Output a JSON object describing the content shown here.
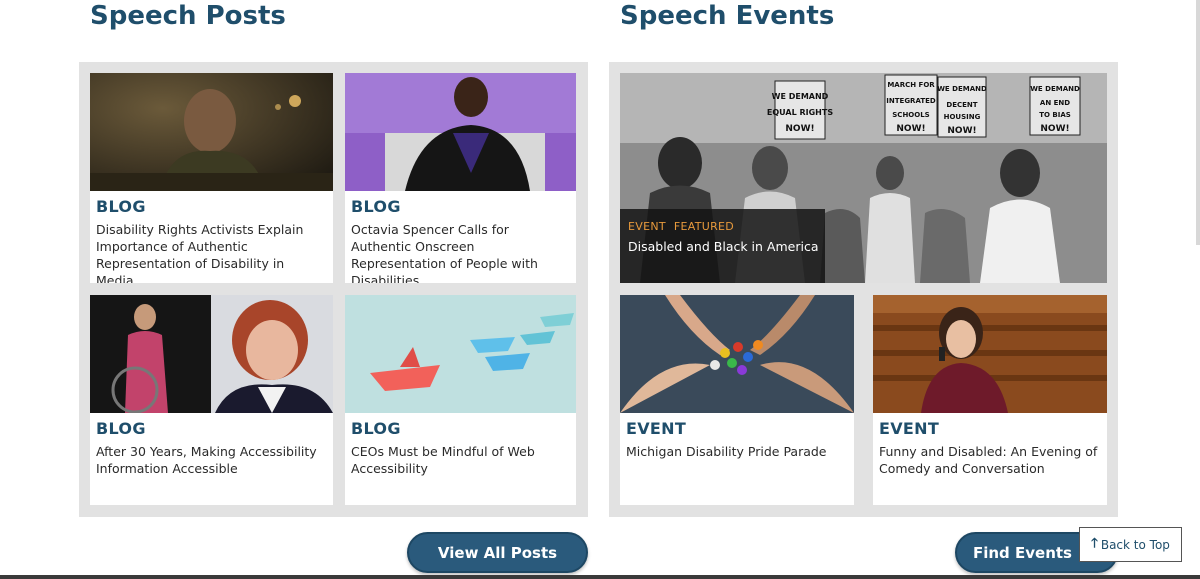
{
  "posts": {
    "title": "Speech Posts",
    "cards": [
      {
        "tag": "BLOG",
        "title": "Disability Rights Activists Explain Importance of Authentic Representation of Disability in Media",
        "image": "man-seated-at-table-photo"
      },
      {
        "tag": "BLOG",
        "title": "Octavia Spencer Calls for Authentic Onscreen Representation of People with Disabilities",
        "image": "woman-on-talk-show-photo"
      },
      {
        "tag": "BLOG",
        "title": "After 30 Years, Making Accessibility Information Accessible",
        "image": "two-women-portrait-photo"
      },
      {
        "tag": "BLOG",
        "title": "CEOs Must be Mindful of Web Accessibility",
        "image": "paper-boats-photo"
      }
    ],
    "button_label": "View All Posts"
  },
  "events": {
    "title": "Speech Events",
    "featured": {
      "tags": [
        "EVENT",
        "FEATURED"
      ],
      "title": "Disabled and Black in America",
      "image": "civil-rights-march-photo",
      "signs": [
        "WE DEMAND EQUAL RIGHTS NOW!",
        "MARCH FOR INTEGRATED SCHOOLS NOW!",
        "WE DEMAND DECENT HOUSING NOW!",
        "WE DEMAND AN END TO BIAS NOW!"
      ]
    },
    "cards": [
      {
        "tag": "EVENT",
        "title": "Michigan Disability Pride Parade",
        "image": "hands-holding-figurines-photo"
      },
      {
        "tag": "EVENT",
        "title": "Funny and Disabled: An Evening of Comedy and Conversation",
        "image": "woman-with-microphone-photo"
      }
    ],
    "button_label": "Find Events"
  },
  "back_to_top": {
    "label": "Back to Top",
    "icon": "arrow-up-icon"
  },
  "colors": {
    "heading": "#1f4e6b",
    "button": "#2a5a7c",
    "panel": "#e2e2e2",
    "featured_tag": "#e89a3c"
  }
}
